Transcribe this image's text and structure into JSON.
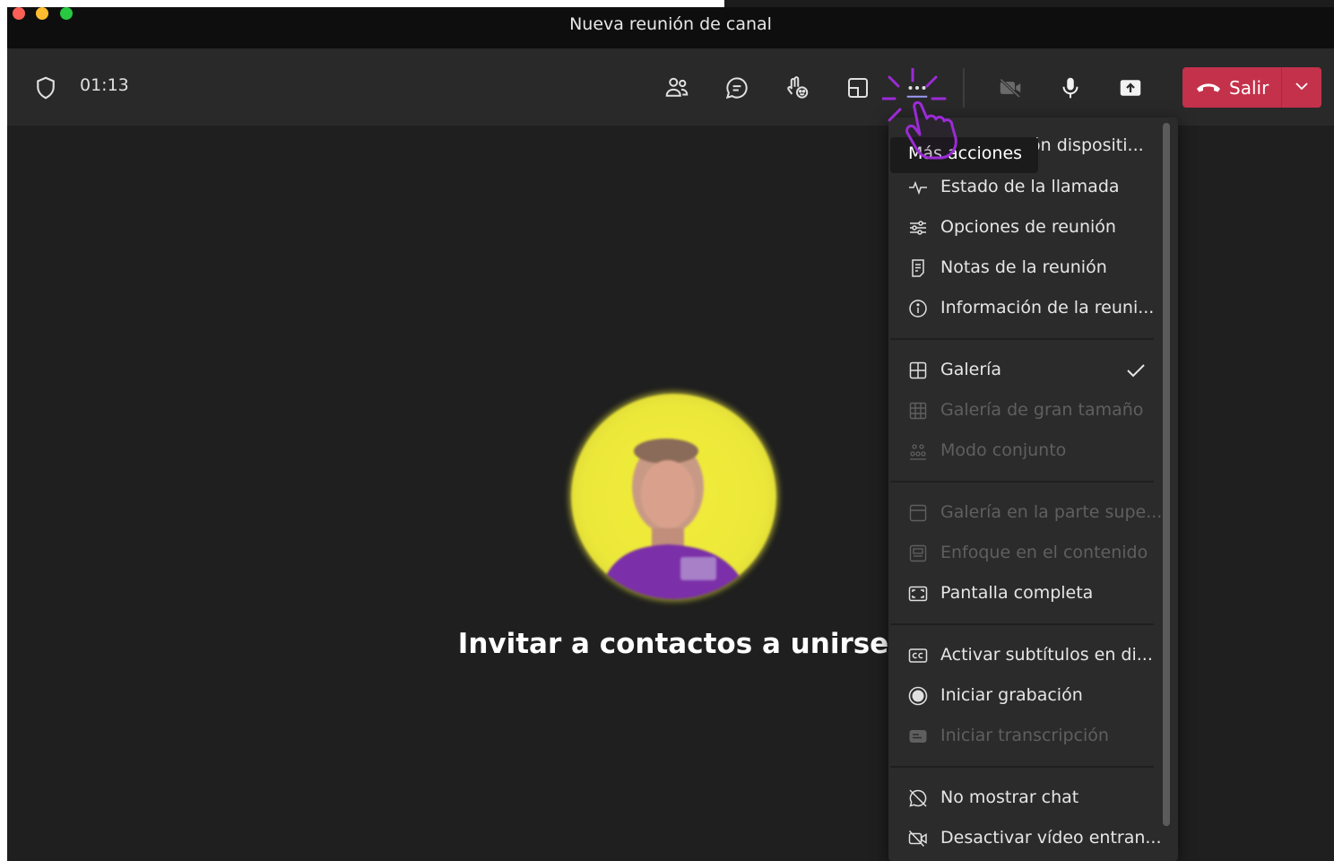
{
  "window": {
    "title": "Nueva reunión de canal"
  },
  "toolbar": {
    "timer": "01:13",
    "buttons": {
      "participants": "participants-icon",
      "chat": "chat-icon",
      "reactions": "reactions-icon",
      "rooms": "rooms-icon",
      "more": "more-actions-icon",
      "camera": "camera-off-icon",
      "mic": "microphone-icon",
      "share": "share-screen-icon"
    },
    "leave_label": "Salir"
  },
  "stage": {
    "invite_text": "Invitar a contactos a unirse"
  },
  "menu": {
    "tooltip": "Más acciones",
    "partial_item": "ón dispositi...",
    "groups": [
      {
        "items": [
          {
            "label": "Estado de la llamada",
            "icon": "activity-icon",
            "enabled": true
          },
          {
            "label": "Opciones de reunión",
            "icon": "sliders-icon",
            "enabled": true
          },
          {
            "label": "Notas de la reunión",
            "icon": "notes-icon",
            "enabled": true
          },
          {
            "label": "Información de la reuni...",
            "icon": "info-icon",
            "enabled": true
          }
        ]
      },
      {
        "items": [
          {
            "label": "Galería",
            "icon": "grid-icon",
            "enabled": true,
            "checked": true
          },
          {
            "label": "Galería de gran tamaño",
            "icon": "large-grid-icon",
            "enabled": false
          },
          {
            "label": "Modo conjunto",
            "icon": "together-icon",
            "enabled": false
          }
        ]
      },
      {
        "items": [
          {
            "label": "Galería en la parte supe...",
            "icon": "gallery-top-icon",
            "enabled": false
          },
          {
            "label": "Enfoque en el contenido",
            "icon": "content-focus-icon",
            "enabled": false
          },
          {
            "label": "Pantalla completa",
            "icon": "fullscreen-icon",
            "enabled": true
          }
        ]
      },
      {
        "items": [
          {
            "label": "Activar subtítulos en di...",
            "icon": "captions-icon",
            "enabled": true
          },
          {
            "label": "Iniciar grabación",
            "icon": "record-icon",
            "enabled": true
          },
          {
            "label": "Iniciar transcripción",
            "icon": "transcript-icon",
            "enabled": false
          }
        ]
      },
      {
        "items": [
          {
            "label": "No mostrar chat",
            "icon": "chat-off-icon",
            "enabled": true
          },
          {
            "label": "Desactivar vídeo entran...",
            "icon": "video-off-icon",
            "enabled": true
          }
        ]
      }
    ]
  },
  "colors": {
    "leave": "#c4314b",
    "accent": "#9b2bd6",
    "avatar_bg": "#ece83a"
  }
}
